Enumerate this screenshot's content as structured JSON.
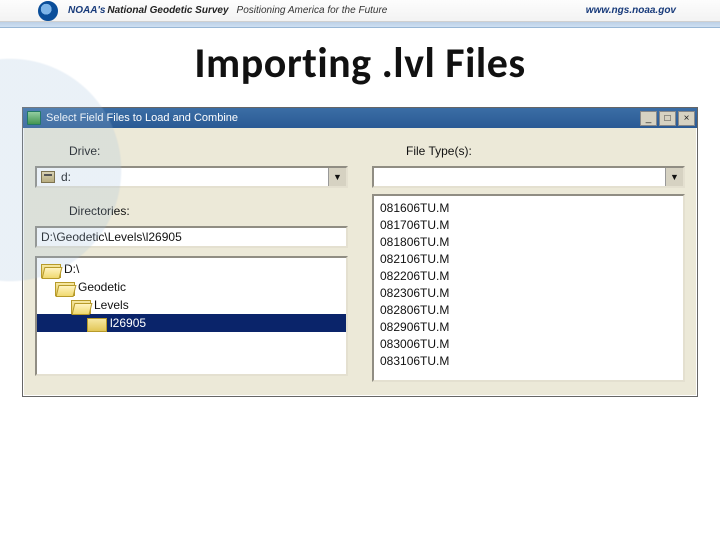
{
  "banner": {
    "org_prefix": "NOAA's",
    "org_name": "National Geodetic Survey",
    "tagline": "Positioning America for the Future",
    "url": "www.ngs.noaa.gov"
  },
  "slide": {
    "title": "Importing .lvl Files"
  },
  "dialog": {
    "title": "Select Field Files to Load and Combine",
    "labels": {
      "drive": "Drive:",
      "file_type": "File Type(s):",
      "directories": "Directories:"
    },
    "drive": {
      "value": "d:"
    },
    "file_type": {
      "value": ""
    },
    "path": "D:\\Geodetic\\Levels\\l26905",
    "tree": [
      {
        "label": "D:\\",
        "indent": 0,
        "open": true,
        "selected": false
      },
      {
        "label": "Geodetic",
        "indent": 1,
        "open": true,
        "selected": false
      },
      {
        "label": "Levels",
        "indent": 2,
        "open": true,
        "selected": false
      },
      {
        "label": "l26905",
        "indent": 3,
        "open": false,
        "selected": true
      }
    ],
    "files": [
      "081606TU.M",
      "081706TU.M",
      "081806TU.M",
      "082106TU.M",
      "082206TU.M",
      "082306TU.M",
      "082806TU.M",
      "082906TU.M",
      "083006TU.M",
      "083106TU.M"
    ],
    "winbtns": {
      "min": "_",
      "max": "□",
      "close": "×"
    }
  }
}
